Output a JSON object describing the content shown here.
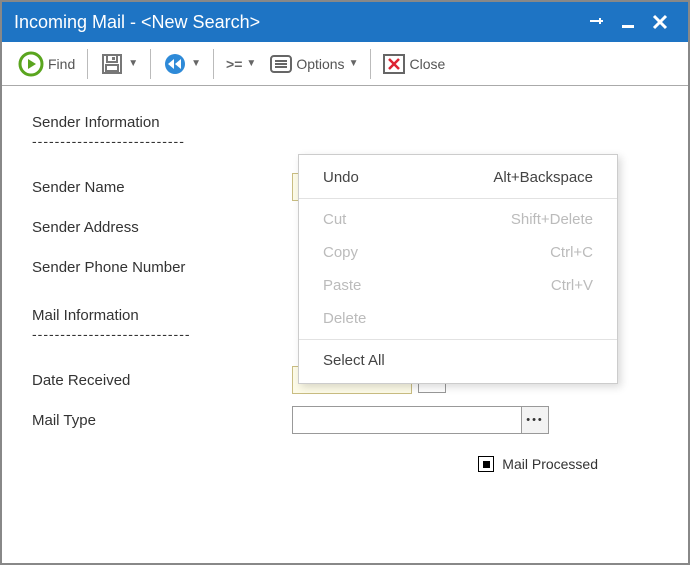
{
  "window": {
    "title": "Incoming Mail - <New Search>"
  },
  "toolbar": {
    "find_label": "Find",
    "options_label": "Options",
    "close_label": "Close",
    "filter_symbol": ">="
  },
  "sections": {
    "sender_header": "Sender Information",
    "sender_dashes": "---------------------------",
    "mail_header": "Mail Information",
    "mail_dashes": "----------------------------"
  },
  "labels": {
    "sender_name": "Sender Name",
    "sender_address": "Sender Address",
    "sender_phone": "Sender Phone Number",
    "date_received": "Date Received",
    "mail_type": "Mail Type",
    "mail_processed": "Mail Processed"
  },
  "fields": {
    "sender_name": "",
    "sender_address": "",
    "sender_phone": "",
    "date_received": "",
    "mail_type": ""
  },
  "picker_ellipsis": "•••",
  "mail_processed_checked": true,
  "context_menu": {
    "undo": {
      "label": "Undo",
      "shortcut": "Alt+Backspace",
      "enabled": true
    },
    "cut": {
      "label": "Cut",
      "shortcut": "Shift+Delete",
      "enabled": false
    },
    "copy": {
      "label": "Copy",
      "shortcut": "Ctrl+C",
      "enabled": false
    },
    "paste": {
      "label": "Paste",
      "shortcut": "Ctrl+V",
      "enabled": false
    },
    "delete": {
      "label": "Delete",
      "shortcut": "",
      "enabled": false
    },
    "selectall": {
      "label": "Select All",
      "shortcut": "",
      "enabled": true
    }
  }
}
